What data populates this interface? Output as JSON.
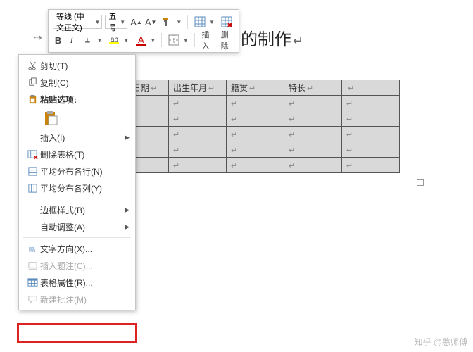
{
  "toolbar": {
    "font_name": "等线 (中文正文)",
    "font_size": "五号",
    "insert_label": "插入",
    "delete_label": "删除"
  },
  "doc": {
    "title_fragment": "的制作"
  },
  "table": {
    "headers": [
      "入党日期",
      "出生年月",
      "籍贯",
      "特长"
    ]
  },
  "menu": {
    "cut": "剪切(T)",
    "copy": "复制(C)",
    "paste_options": "粘贴选项:",
    "insert": "插入(I)",
    "delete_table": "删除表格(T)",
    "distribute_rows": "平均分布各行(N)",
    "distribute_cols": "平均分布各列(Y)",
    "border_styles": "边框样式(B)",
    "autofit": "自动调整(A)",
    "text_direction": "文字方向(X)...",
    "insert_caption": "插入题注(C)...",
    "table_properties": "表格属性(R)...",
    "new_comment": "新建批注(M)"
  },
  "watermark": "知乎 @憨师傅"
}
